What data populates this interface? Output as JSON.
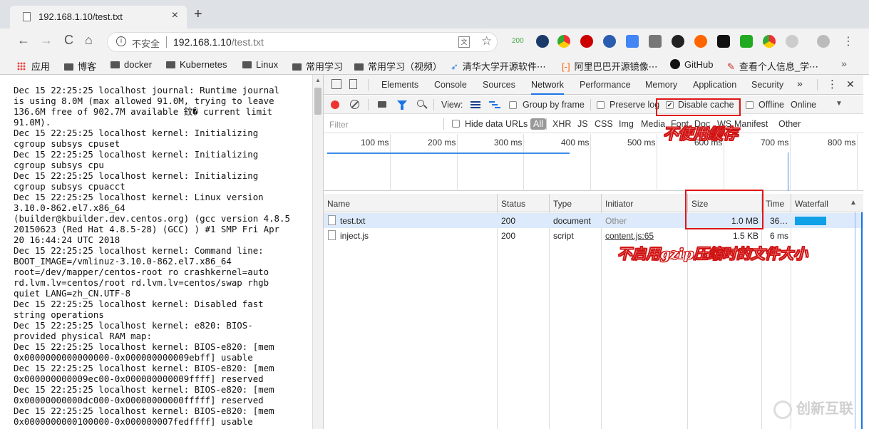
{
  "browser": {
    "tab_title": "192.168.1.10/test.txt",
    "tab_close": "×",
    "new_tab": "+",
    "back": "←",
    "forward": "→",
    "reload": "C",
    "home": "⌂",
    "insecure_label": "不安全",
    "url_host": "192.168.1.10",
    "url_path": "/test.txt",
    "ext_badge": "200",
    "bookmarks": [
      {
        "label": "应用"
      },
      {
        "label": "博客"
      },
      {
        "label": "docker"
      },
      {
        "label": "Kubernetes"
      },
      {
        "label": "Linux"
      },
      {
        "label": "常用学习"
      },
      {
        "label": "常用学习（视频）"
      },
      {
        "label": "清华大学开源软件⋯"
      },
      {
        "label": "阿里巴巴开源镜像⋯"
      },
      {
        "label": "GitHub"
      },
      {
        "label": "查看个人信息_学⋯"
      }
    ],
    "bookmarks_more": "»"
  },
  "terminal": {
    "lines": "Dec 15 22:25:25 localhost journal: Runtime journal\nis using 8.0M (max allowed 91.0M, trying to leave\n136.6M free of 902.7M available 鈫� current limit\n91.0M).\nDec 15 22:25:25 localhost kernel: Initializing\ncgroup subsys cpuset\nDec 15 22:25:25 localhost kernel: Initializing\ncgroup subsys cpu\nDec 15 22:25:25 localhost kernel: Initializing\ncgroup subsys cpuacct\nDec 15 22:25:25 localhost kernel: Linux version\n3.10.0-862.el7.x86_64\n(builder@kbuilder.dev.centos.org) (gcc version 4.8.5\n20150623 (Red Hat 4.8.5-28) (GCC) ) #1 SMP Fri Apr\n20 16:44:24 UTC 2018\nDec 15 22:25:25 localhost kernel: Command line:\nBOOT_IMAGE=/vmlinuz-3.10.0-862.el7.x86_64\nroot=/dev/mapper/centos-root ro crashkernel=auto\nrd.lvm.lv=centos/root rd.lvm.lv=centos/swap rhgb\nquiet LANG=zh_CN.UTF-8\nDec 15 22:25:25 localhost kernel: Disabled fast\nstring operations\nDec 15 22:25:25 localhost kernel: e820: BIOS-\nprovided physical RAM map:\nDec 15 22:25:25 localhost kernel: BIOS-e820: [mem\n0x0000000000000000-0x000000000009ebff] usable\nDec 15 22:25:25 localhost kernel: BIOS-e820: [mem\n0x000000000009ec00-0x000000000009ffff] reserved\nDec 15 22:25:25 localhost kernel: BIOS-e820: [mem\n0x00000000000dc000-0x00000000000fffff] reserved\nDec 15 22:25:25 localhost kernel: BIOS-e820: [mem\n0x0000000000100000-0x000000007fedffff] usable"
  },
  "devtools": {
    "tabs": [
      "Elements",
      "Console",
      "Sources",
      "Network",
      "Performance",
      "Memory",
      "Application",
      "Security"
    ],
    "tabs_more": "»",
    "close": "✕",
    "kebab": "⋮",
    "view_label": "View:",
    "group_by_frame": "Group by frame",
    "preserve_log": "Preserve log",
    "disable_cache": "Disable cache",
    "offline": "Offline",
    "online": "Online",
    "filter_placeholder": "Filter",
    "hide_data_urls": "Hide data URLs",
    "filter_types": [
      "All",
      "XHR",
      "JS",
      "CSS",
      "Img",
      "Media",
      "Font",
      "Doc",
      "WS",
      "Manifest",
      "Other"
    ],
    "ticks": [
      "100 ms",
      "200 ms",
      "300 ms",
      "400 ms",
      "500 ms",
      "600 ms",
      "700 ms",
      "800 ms"
    ],
    "columns": [
      "Name",
      "Status",
      "Type",
      "Initiator",
      "Size",
      "Time",
      "Waterfall"
    ],
    "rows": [
      {
        "name": "test.txt",
        "status": "200",
        "type": "document",
        "initiator": "Other",
        "size": "1.0 MB",
        "time": "36…"
      },
      {
        "name": "inject.js",
        "status": "200",
        "type": "script",
        "initiator": "content.js:65",
        "size": "1.5 KB",
        "time": "6 ms"
      }
    ]
  },
  "annotations": {
    "no_cache": "不使用缓存",
    "no_gzip": "不启用gzip压缩时的文件大小"
  },
  "watermark": "创新互联"
}
